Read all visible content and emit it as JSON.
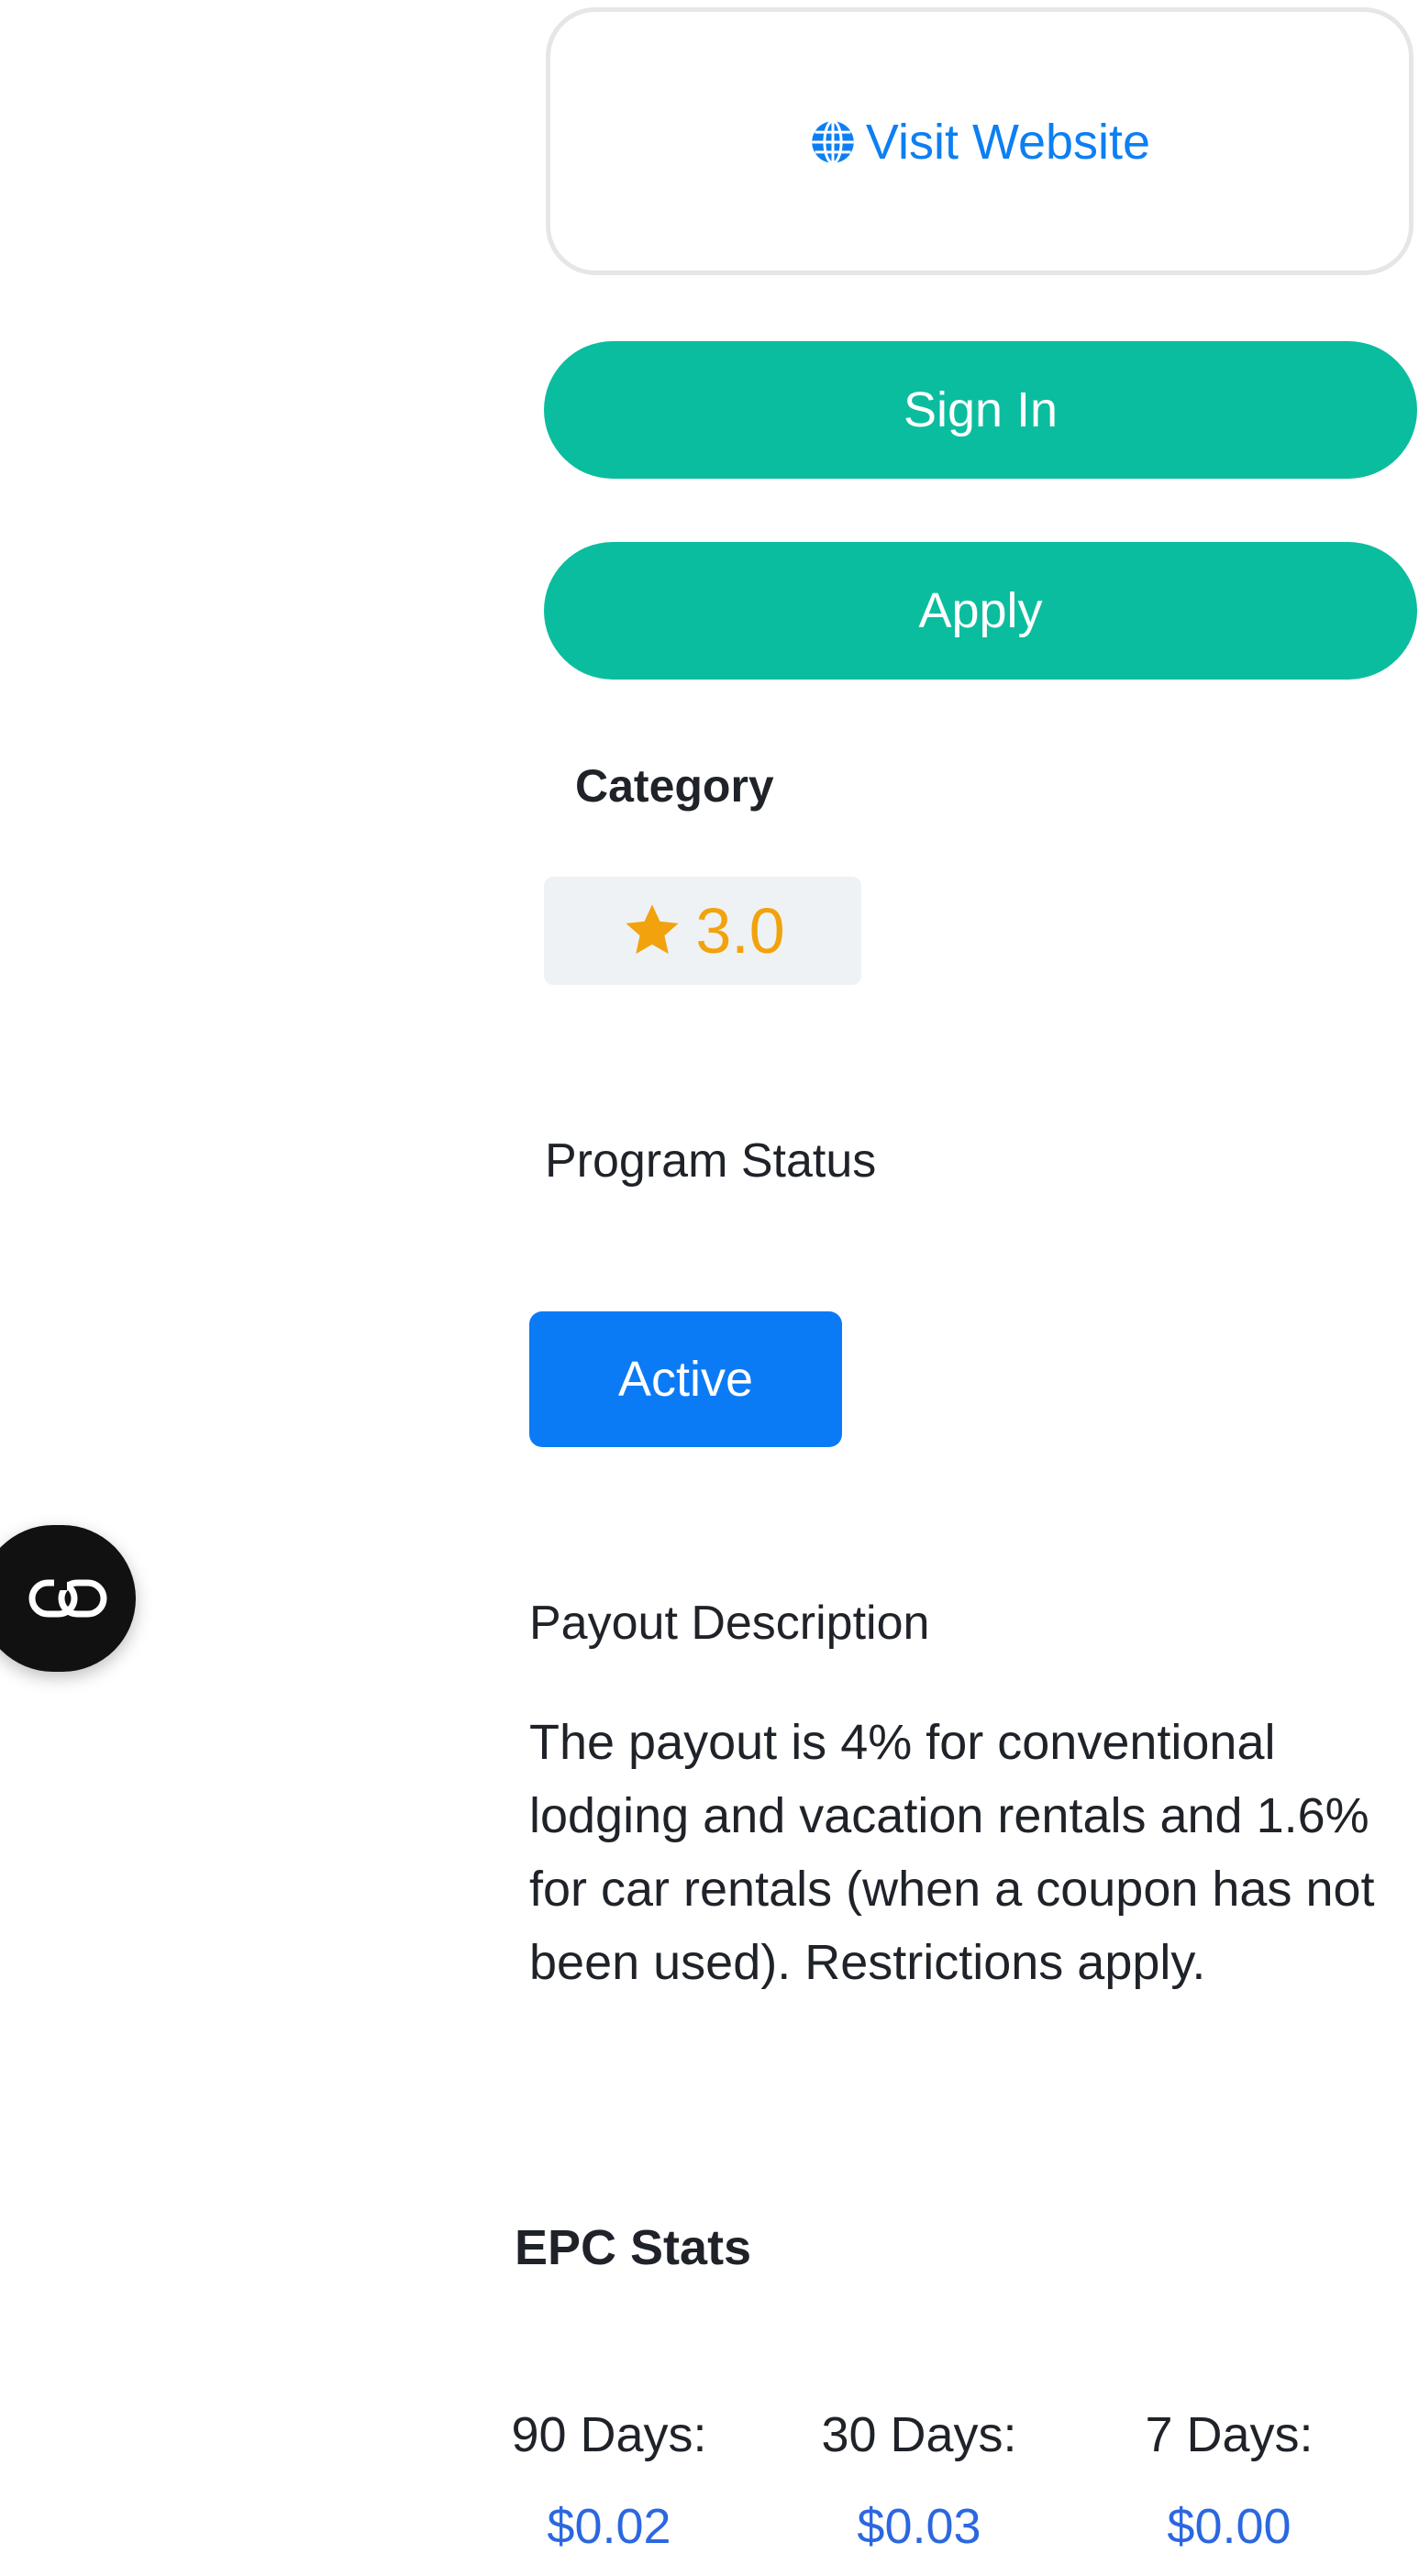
{
  "visit": {
    "label": "Visit Website",
    "icon": "globe-icon",
    "color": "#0d7ff2"
  },
  "buttons": {
    "sign_in": "Sign In",
    "apply": "Apply",
    "color": "#0bbd9f"
  },
  "category": {
    "title": "Category",
    "rating_icon": "star-icon",
    "rating": "3.0",
    "rating_color": "#f2a20c"
  },
  "status": {
    "title": "Program Status",
    "value": "Active",
    "color": "#0b7bf5"
  },
  "floating": {
    "icon": "link-icon"
  },
  "payout": {
    "title": "Payout Description",
    "text": "The payout is 4% for conventional lodging and vacation rentals and 1.6% for car rentals (when a coupon has not been used). Restrictions apply."
  },
  "epc": {
    "title": "EPC Stats",
    "stats": [
      {
        "label": "90 Days:",
        "value": "$0.02"
      },
      {
        "label": "30 Days:",
        "value": "$0.03"
      },
      {
        "label": "7 Days:",
        "value": "$0.00"
      }
    ],
    "value_color": "#2b67e0"
  }
}
